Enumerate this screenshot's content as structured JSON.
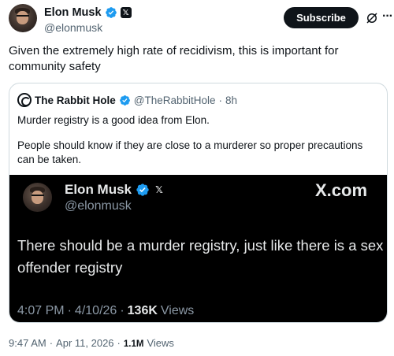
{
  "post": {
    "author_name": "Elon Musk",
    "author_handle": "@elonmusk",
    "subscribe_label": "Subscribe",
    "text": "Given the extremely high rate of recidivism, this is important for community safety",
    "time": "9:47 AM",
    "sep1": "·",
    "date": "Apr 11, 2026",
    "sep2": "·",
    "views_count": "1.1M",
    "views_label": "Views"
  },
  "quote": {
    "author_name": "The Rabbit Hole",
    "author_handle": "@TheRabbitHole",
    "sep": "·",
    "age": "8h",
    "text_line1": "Murder registry is a good idea from Elon.",
    "text_line2": "People should know if they are close to a murderer so proper precautions can be taken."
  },
  "media": {
    "author_name": "Elon Musk",
    "author_handle": "@elonmusk",
    "logo": "X.com",
    "text": "There should be a murder registry, just like there is a sex offender registry",
    "time": "4:07 PM",
    "sep1": "·",
    "date": "4/10/26",
    "sep2": "·",
    "views_count": "136K",
    "views_label": "Views"
  },
  "colors": {
    "verified": "#1d9bf0",
    "text_primary": "#0f1419",
    "text_secondary": "#536471",
    "media_bg": "#000000"
  },
  "icons": [
    "verified-badge-icon",
    "x-affiliation-icon",
    "grok-icon",
    "more-icon"
  ]
}
